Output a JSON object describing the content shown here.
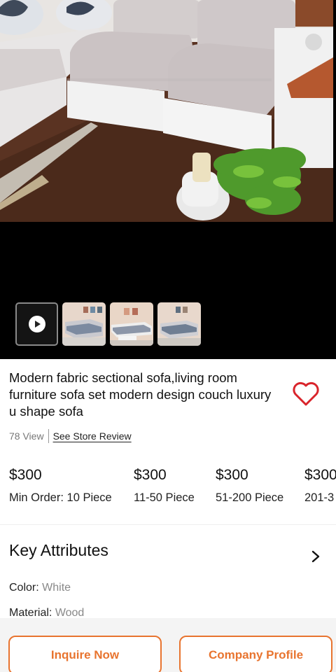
{
  "product": {
    "title": "Modern fabric sectional sofa,living room furniture sofa set modern design couch luxury u shape sofa",
    "views": "78 View",
    "store_review_link": "See Store Review",
    "favorite_icon": "heart-outline-icon"
  },
  "gallery": {
    "play_icon": "play-icon",
    "thumbnail_count": 3
  },
  "pricing": [
    {
      "price": "$300",
      "quantity": "Min Order: 10 Piece"
    },
    {
      "price": "$300",
      "quantity": "11-50 Piece"
    },
    {
      "price": "$300",
      "quantity": "51-200 Piece"
    },
    {
      "price": "$300",
      "quantity": "201-3"
    }
  ],
  "key_attributes": {
    "title": "Key Attributes",
    "chevron_icon": "chevron-right-icon",
    "items": [
      {
        "label": "Color:",
        "value": "White"
      },
      {
        "label": "Material:",
        "value": "Wood"
      }
    ]
  },
  "actions": {
    "inquire_label": "Inquire Now",
    "company_profile_label": "Company Profile"
  },
  "colors": {
    "accent": "#e8742f",
    "favorite": "#d9242b",
    "media_background": "#000000"
  }
}
